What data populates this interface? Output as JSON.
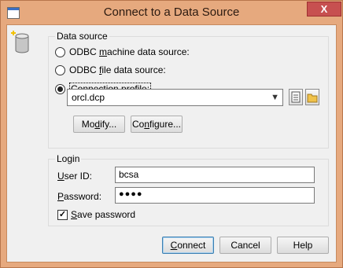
{
  "window": {
    "title": "Connect to a Data Source",
    "close_glyph": "X"
  },
  "datasource": {
    "group_label": "Data source",
    "options": [
      {
        "pre": "ODBC ",
        "key": "m",
        "post": "achine data source:",
        "checked": false
      },
      {
        "pre": "ODBC ",
        "key": "f",
        "post": "ile data source:",
        "checked": false
      },
      {
        "pre": "",
        "key": "C",
        "post": "onnection profile:",
        "checked": true
      }
    ],
    "profile_value": "orcl.dcp",
    "modify": {
      "pre": "Mo",
      "key": "d",
      "post": "ify..."
    },
    "configure": {
      "pre": "Co",
      "key": "n",
      "post": "figure..."
    }
  },
  "login": {
    "group_label": "Login",
    "userid": {
      "pre": "",
      "key": "U",
      "post": "ser ID:",
      "value": "bcsa"
    },
    "password": {
      "pre": "",
      "key": "P",
      "post": "assword:",
      "value": "●●●●"
    },
    "save": {
      "pre": "",
      "key": "S",
      "post": "ave password",
      "checked": true
    }
  },
  "buttons": {
    "connect": {
      "pre": "",
      "key": "C",
      "post": "onnect"
    },
    "cancel": "Cancel",
    "help": "Help"
  },
  "icons": {
    "app": "dialog-app-icon",
    "datasource": "database-cylinder-icon",
    "browse": "document-icon",
    "open": "folder-icon"
  }
}
